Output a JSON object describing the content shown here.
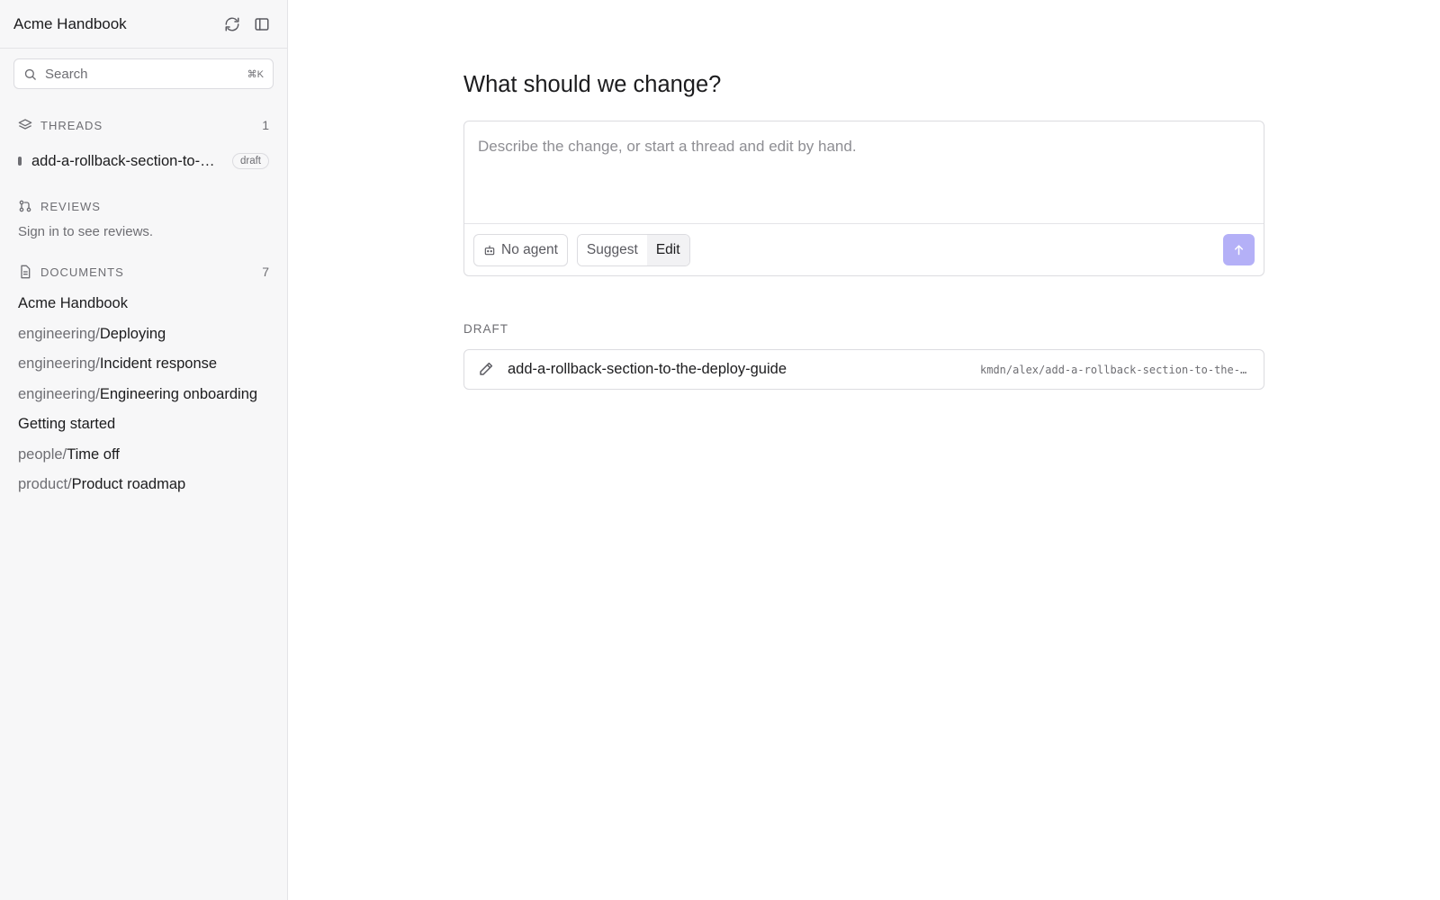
{
  "sidebar": {
    "title": "Acme Handbook",
    "refresh_icon": "refresh-icon",
    "panel_icon": "sidebar-toggle-icon",
    "search": {
      "placeholder": "Search",
      "shortcut": "⌘K"
    },
    "threads": {
      "label": "THREADS",
      "count": "1",
      "items": [
        {
          "name": "add-a-rollback-section-to-the-deploy-guide",
          "badge": "draft"
        }
      ]
    },
    "reviews": {
      "label": "REVIEWS",
      "message": "Sign in to see reviews."
    },
    "documents": {
      "label": "DOCUMENTS",
      "count": "7",
      "items": [
        {
          "prefix": "",
          "name": "Acme Handbook"
        },
        {
          "prefix": "engineering/",
          "name": "Deploying"
        },
        {
          "prefix": "engineering/",
          "name": "Incident response"
        },
        {
          "prefix": "engineering/",
          "name": "Engineering onboarding"
        },
        {
          "prefix": "",
          "name": "Getting started"
        },
        {
          "prefix": "people/",
          "name": "Time off"
        },
        {
          "prefix": "product/",
          "name": "Product roadmap"
        }
      ]
    }
  },
  "main": {
    "heading": "What should we change?",
    "composer": {
      "placeholder": "Describe the change, or start a thread and edit by hand.",
      "agent_button": "No agent",
      "modes": [
        "Suggest",
        "Edit"
      ],
      "active_mode": "Edit",
      "send_icon": "arrow-up-icon"
    },
    "draft": {
      "label": "DRAFT",
      "name": "add-a-rollback-section-to-the-deploy-guide",
      "branch": "kmdn/alex/add-a-rollback-section-to-the-deploy-guide"
    }
  },
  "colors": {
    "accent": "#b4b0f7",
    "sidebar_bg": "#f7f7f8",
    "border": "#dcdce0",
    "muted_text": "#6e6e73"
  }
}
